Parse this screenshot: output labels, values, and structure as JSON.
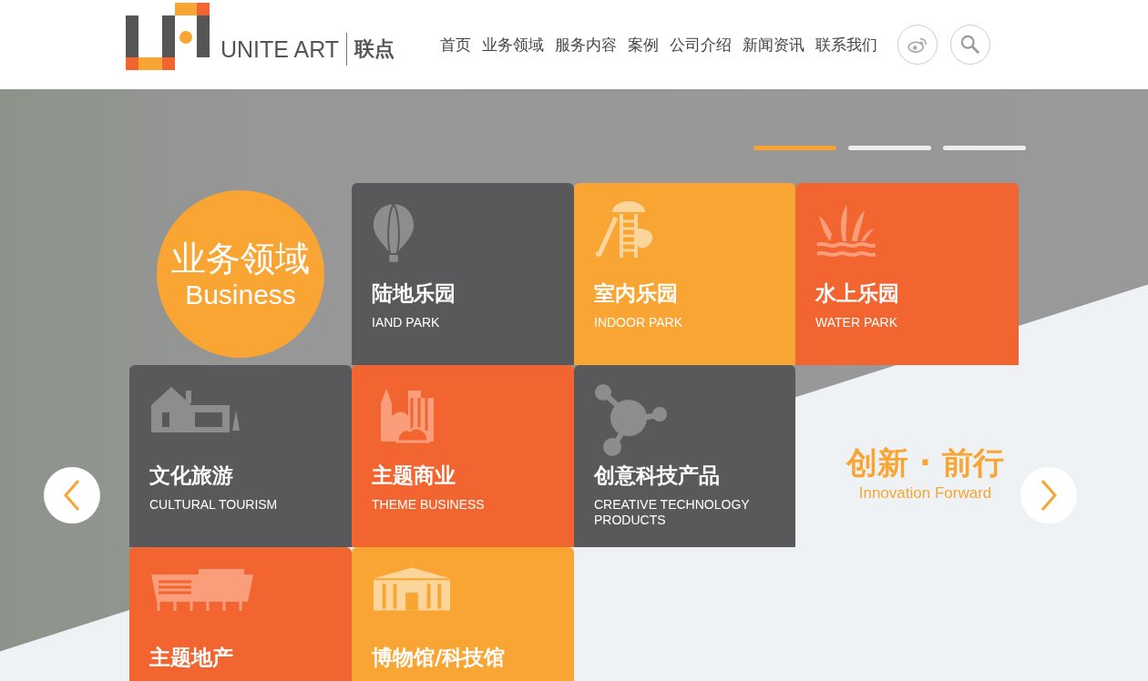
{
  "header": {
    "logo": {
      "name": "UNITE ART",
      "cn": "联点"
    },
    "nav": [
      {
        "label": "首页"
      },
      {
        "label": "业务领域"
      },
      {
        "label": "服务内容"
      },
      {
        "label": "案例"
      },
      {
        "label": "公司介绍"
      },
      {
        "label": "新闻资讯"
      },
      {
        "label": "联系我们"
      }
    ]
  },
  "hero": {
    "slides": [
      {
        "selected": true
      },
      {
        "selected": false
      },
      {
        "selected": false
      }
    ],
    "badge": {
      "title": "业务领域",
      "subtitle": "Business"
    },
    "tiles": [
      {
        "title": "陆地乐园",
        "subtitle": "IAND PARK",
        "color": "#59595b",
        "kind": "balloon"
      },
      {
        "title": "室内乐园",
        "subtitle": "INDOOR PARK",
        "color": "#f9a533",
        "kind": "slide"
      },
      {
        "title": "水上乐园",
        "subtitle": "WATER PARK",
        "color": "#f26531",
        "kind": "water"
      },
      {
        "title": "文化旅游",
        "subtitle": "CULTURAL TOURISM",
        "color": "#59595b",
        "kind": "house"
      },
      {
        "title": "主题商业",
        "subtitle": "THEME BUSINESS",
        "color": "#f26531",
        "kind": "town"
      },
      {
        "title": "创意科技产品",
        "subtitle": "CREATIVE TECHNOLOGY PRODUCTS",
        "color": "#59595b",
        "kind": "molecule"
      },
      {
        "title": "主题地产",
        "color": "#f26531",
        "kind": "building"
      },
      {
        "title": "博物馆/科技馆",
        "color": "#f9a533",
        "kind": "museum"
      }
    ],
    "slogan": {
      "title": "创新 · 前行",
      "subtitle": "Innovation Forward"
    }
  }
}
